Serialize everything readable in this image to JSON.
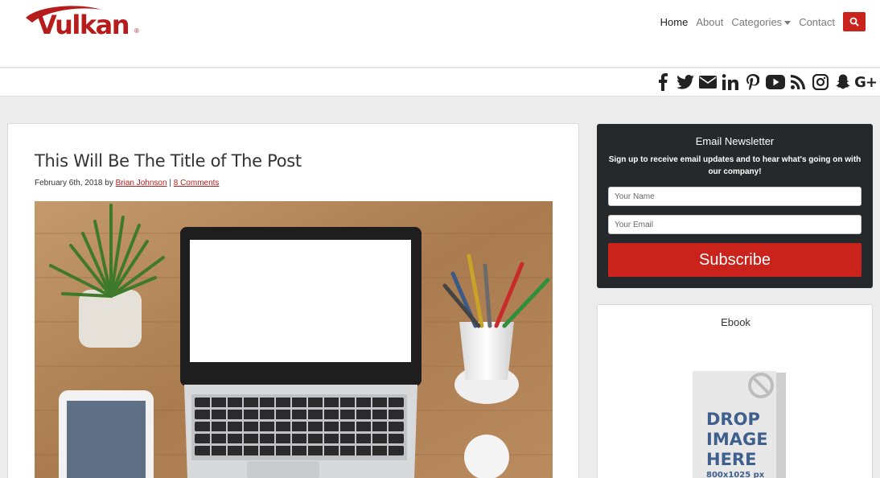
{
  "header": {
    "logo_text": "Vulkan",
    "logo_mark": "®",
    "nav": {
      "home": "Home",
      "about": "About",
      "categories": "Categories",
      "contact": "Contact"
    }
  },
  "social": {
    "icons": [
      "facebook-icon",
      "twitter-icon",
      "email-icon",
      "linkedin-icon",
      "pinterest-icon",
      "youtube-icon",
      "rss-icon",
      "instagram-icon",
      "snapchat-icon",
      "google-plus-icon"
    ],
    "google_plus_label": "G+"
  },
  "post": {
    "title": "This Will Be The Title of The Post",
    "date": "February 6th, 2018",
    "by": "by",
    "author": "Brian Johnson",
    "separator": "|",
    "comments": "8 Comments"
  },
  "newsletter": {
    "title": "Email Newsletter",
    "description": "Sign up to receive email updates and to hear what's going on with our company!",
    "name_placeholder": "Your Name",
    "email_placeholder": "Your Email",
    "button": "Subscribe"
  },
  "ebook": {
    "title": "Ebook",
    "cover_line1": "DROP",
    "cover_line2": "IMAGE",
    "cover_line3": "HERE",
    "cover_size": "800x1025 px"
  },
  "colors": {
    "brand_red": "#c9231c",
    "dark_panel": "#26292b",
    "page_bg": "#ececec"
  }
}
